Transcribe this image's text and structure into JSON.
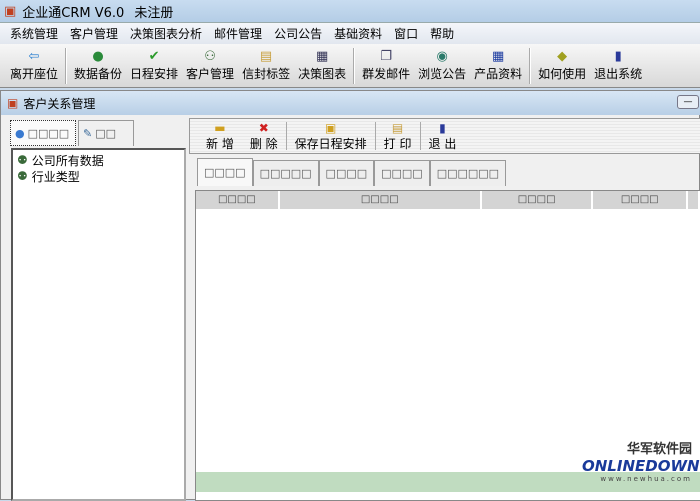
{
  "app": {
    "title": "企业通CRM V6.0",
    "status": "未注册"
  },
  "menu": [
    "系统管理",
    "客户管理",
    "决策图表分析",
    "邮件管理",
    "公司公告",
    "基础资料",
    "窗口",
    "帮助"
  ],
  "toolbar": [
    {
      "label": "离开座位",
      "icon": "⇦",
      "color": "#2a7fd0"
    },
    {
      "label": "数据备份",
      "icon": "●",
      "color": "#2a8a3a"
    },
    {
      "label": "日程安排",
      "icon": "✔",
      "color": "#2a9a2a"
    },
    {
      "label": "客户管理",
      "icon": "⚇",
      "color": "#3a6a3a"
    },
    {
      "label": "信封标签",
      "icon": "▤",
      "color": "#c8a040"
    },
    {
      "label": "决策图表",
      "icon": "▦",
      "color": "#335"
    },
    {
      "label": "群发邮件",
      "icon": "❐",
      "color": "#446"
    },
    {
      "label": "浏览公告",
      "icon": "◉",
      "color": "#2a7a6a"
    },
    {
      "label": "产品资料",
      "icon": "▦",
      "color": "#1a3aa0"
    },
    {
      "label": "如何使用",
      "icon": "◆",
      "color": "#a0a020"
    },
    {
      "label": "退出系统",
      "icon": "▮",
      "color": "#2a3a9a"
    }
  ],
  "inner": {
    "title": "客户关系管理",
    "minimize": "—"
  },
  "left": {
    "tabs": [
      "□□□□",
      "□□"
    ],
    "tree": [
      "公司所有数据",
      "行业类型"
    ]
  },
  "right": {
    "buttons": [
      {
        "label": "新 增",
        "icon": "▬",
        "color": "#d0a020"
      },
      {
        "label": "删 除",
        "icon": "✖",
        "color": "#d02020"
      },
      {
        "label": "保存日程安排",
        "icon": "▣",
        "color": "#d0a020"
      },
      {
        "label": "打 印",
        "icon": "▤",
        "color": "#c8a040"
      },
      {
        "label": "退 出",
        "icon": "▮",
        "color": "#2a3a9a"
      }
    ],
    "tabs": [
      "□□□□",
      "□□□□□",
      "□□□□",
      "□□□□",
      "□□□□□□"
    ],
    "columns": [
      "□□□□",
      "□□□□",
      "□□□□",
      "□□□□",
      ""
    ]
  },
  "watermark": {
    "cn": "华军软件园",
    "brand": "ONLINEDOWN",
    "url": "www.newhua.com"
  }
}
